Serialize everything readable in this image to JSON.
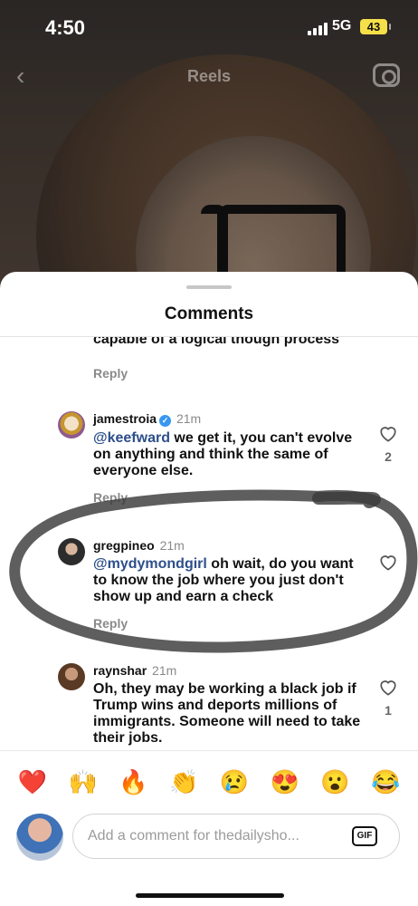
{
  "status_bar": {
    "time": "4:50",
    "network": "5G",
    "battery": "43",
    "battery_color": "#f6e04a"
  },
  "reel": {
    "title": "Reels",
    "back_icon": "chevron-left-icon",
    "camera_icon": "camera-icon"
  },
  "sheet": {
    "title": "Comments"
  },
  "comments": {
    "partial": {
      "text": "capable  of a logical though process",
      "reply_label": "Reply"
    },
    "items": [
      {
        "username": "jamestroia",
        "verified": true,
        "time": "21m",
        "mention": "@keefward",
        "text": " we get it, you can't evolve on anything and think the same of everyone else.",
        "reply_label": "Reply",
        "likes": "2"
      },
      {
        "username": "gregpineo",
        "time": "21m",
        "mention": "@mydymondgirl",
        "text": " oh wait, do you want to know the job where you just don't show up and earn a check",
        "reply_label": "Reply",
        "likes": ""
      },
      {
        "username": "raynshar",
        "time": "21m",
        "mention": "",
        "text": "Oh, they may be working a black job if Trump wins and deports millions of immigrants. Someone will need to take their jobs.",
        "reply_label": "",
        "likes": "1"
      }
    ]
  },
  "emoji_bar": [
    "❤️",
    "🙌",
    "🔥",
    "👏",
    "😢",
    "😍",
    "😮",
    "😂"
  ],
  "input": {
    "placeholder": "Add a comment for thedailysho...",
    "gif_label": "GIF"
  }
}
